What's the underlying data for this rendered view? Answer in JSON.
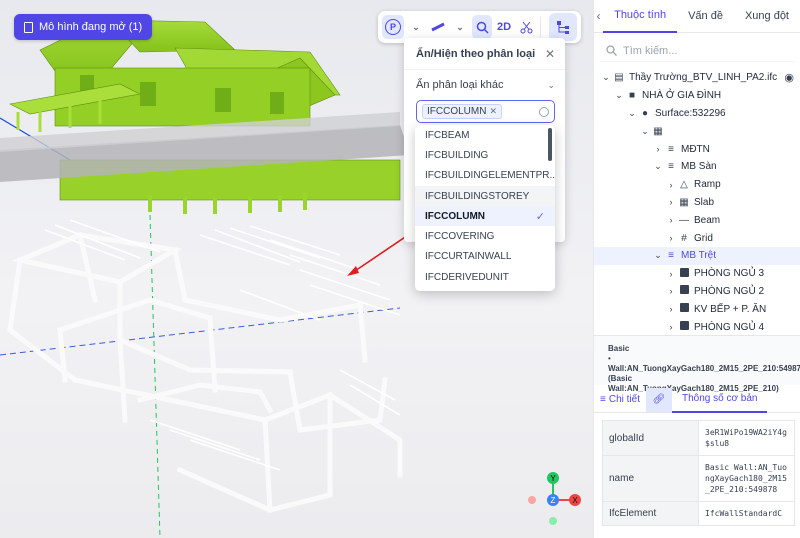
{
  "viewport": {
    "model_badge": "Mô hình đang mở (1)"
  },
  "toolbar": {
    "p_label": "P",
    "twod_label": "2D"
  },
  "filter_popover": {
    "title": "Ẩn/Hiện theo phân loại",
    "section": "Ẩn phân loại khác",
    "selected_tag": "IFCCOLUMN",
    "options": [
      "IFCBEAM",
      "IFCBUILDING",
      "IFCBUILDINGELEMENTPR...",
      "IFCBUILDINGSTOREY",
      "IFCCOLUMN",
      "IFCCOVERING",
      "IFCCURTAINWALL",
      "IFCDERIVEDUNIT"
    ],
    "hovered_option": "IFCBUILDINGSTOREY",
    "selected_option": "IFCCOLUMN"
  },
  "panel": {
    "tabs": [
      "Thuộc tính",
      "Vấn đề",
      "Xung đột"
    ],
    "active_tab": "Thuộc tính",
    "search_placeholder": "Tìm kiếm...",
    "tree": [
      {
        "label": "Thầy Trường_BTV_LINH_PA2.ifc",
        "level": 0,
        "expanded": true,
        "icon": "building-icon"
      },
      {
        "label": "NHÀ Ở GIA ĐÌNH",
        "level": 1,
        "expanded": true,
        "icon": "folder-icon"
      },
      {
        "label": "Surface:532296",
        "level": 2,
        "expanded": true,
        "icon": "globe-icon"
      },
      {
        "label": "",
        "level": 3,
        "expanded": true,
        "icon": "building-small-icon"
      },
      {
        "label": "MĐTN",
        "level": 4,
        "expanded": false,
        "icon": "list-icon"
      },
      {
        "label": "MB Sàn",
        "level": 4,
        "expanded": true,
        "icon": "list-icon"
      },
      {
        "label": "Ramp",
        "level": 5,
        "expanded": false,
        "icon": "triangle-icon"
      },
      {
        "label": "Slab",
        "level": 5,
        "expanded": false,
        "icon": "grid-icon"
      },
      {
        "label": "Beam",
        "level": 5,
        "expanded": false,
        "icon": "minus-icon"
      },
      {
        "label": "Grid",
        "level": 5,
        "expanded": false,
        "icon": "hash-icon"
      },
      {
        "label": "MB Trệt",
        "level": 4,
        "expanded": true,
        "icon": "list-icon",
        "selected": true
      },
      {
        "label": "PHÒNG NGỦ 3",
        "level": 5,
        "expanded": false,
        "icon": "room-icon"
      },
      {
        "label": "PHÒNG NGỦ 2",
        "level": 5,
        "expanded": false,
        "icon": "room-icon"
      },
      {
        "label": "KV BẾP + P. ĂN",
        "level": 5,
        "expanded": false,
        "icon": "room-icon"
      },
      {
        "label": "PHÒNG NGỦ 4",
        "level": 5,
        "expanded": false,
        "icon": "room-icon"
      }
    ],
    "info_line1": "Basic",
    "info_line2": "Wall:AN_TuongXayGach180_2M15_2PE_210:549878",
    "info_line3": "(Basic Wall:AN_TuongXayGach180_2M15_2PE_210)",
    "subtabs": {
      "detail": "Chi tiết",
      "basic": "Thông số cơ bản"
    },
    "properties": [
      {
        "key": "globalId",
        "value": "3eR1WiPo19WA2iY4g$slu8"
      },
      {
        "key": "name",
        "value": "Basic Wall:AN_TuongXayGach180_2M15_2PE_210:549878"
      },
      {
        "key": "IfcElement",
        "value": "IfcWallStandardC"
      }
    ]
  },
  "colors": {
    "accent": "#4f46e5",
    "house_green": "#9bd52a",
    "structure": "#ffffff",
    "arrow": "#e11d1d"
  }
}
